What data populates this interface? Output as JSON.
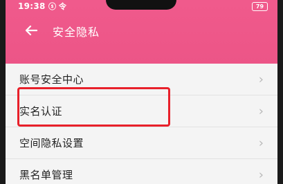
{
  "status_bar": {
    "time": "19:38",
    "icons": "ⓢ 令",
    "battery": "79"
  },
  "header": {
    "title": "安全隐私",
    "back_icon": "arrow-left-icon"
  },
  "menu": {
    "items": [
      {
        "label": "账号安全中心"
      },
      {
        "label": "实名认证"
      },
      {
        "label": "空间隐私设置"
      },
      {
        "label": "黑名单管理"
      }
    ]
  },
  "colors": {
    "accent": "#ec5587",
    "highlight": "#e8202a"
  }
}
